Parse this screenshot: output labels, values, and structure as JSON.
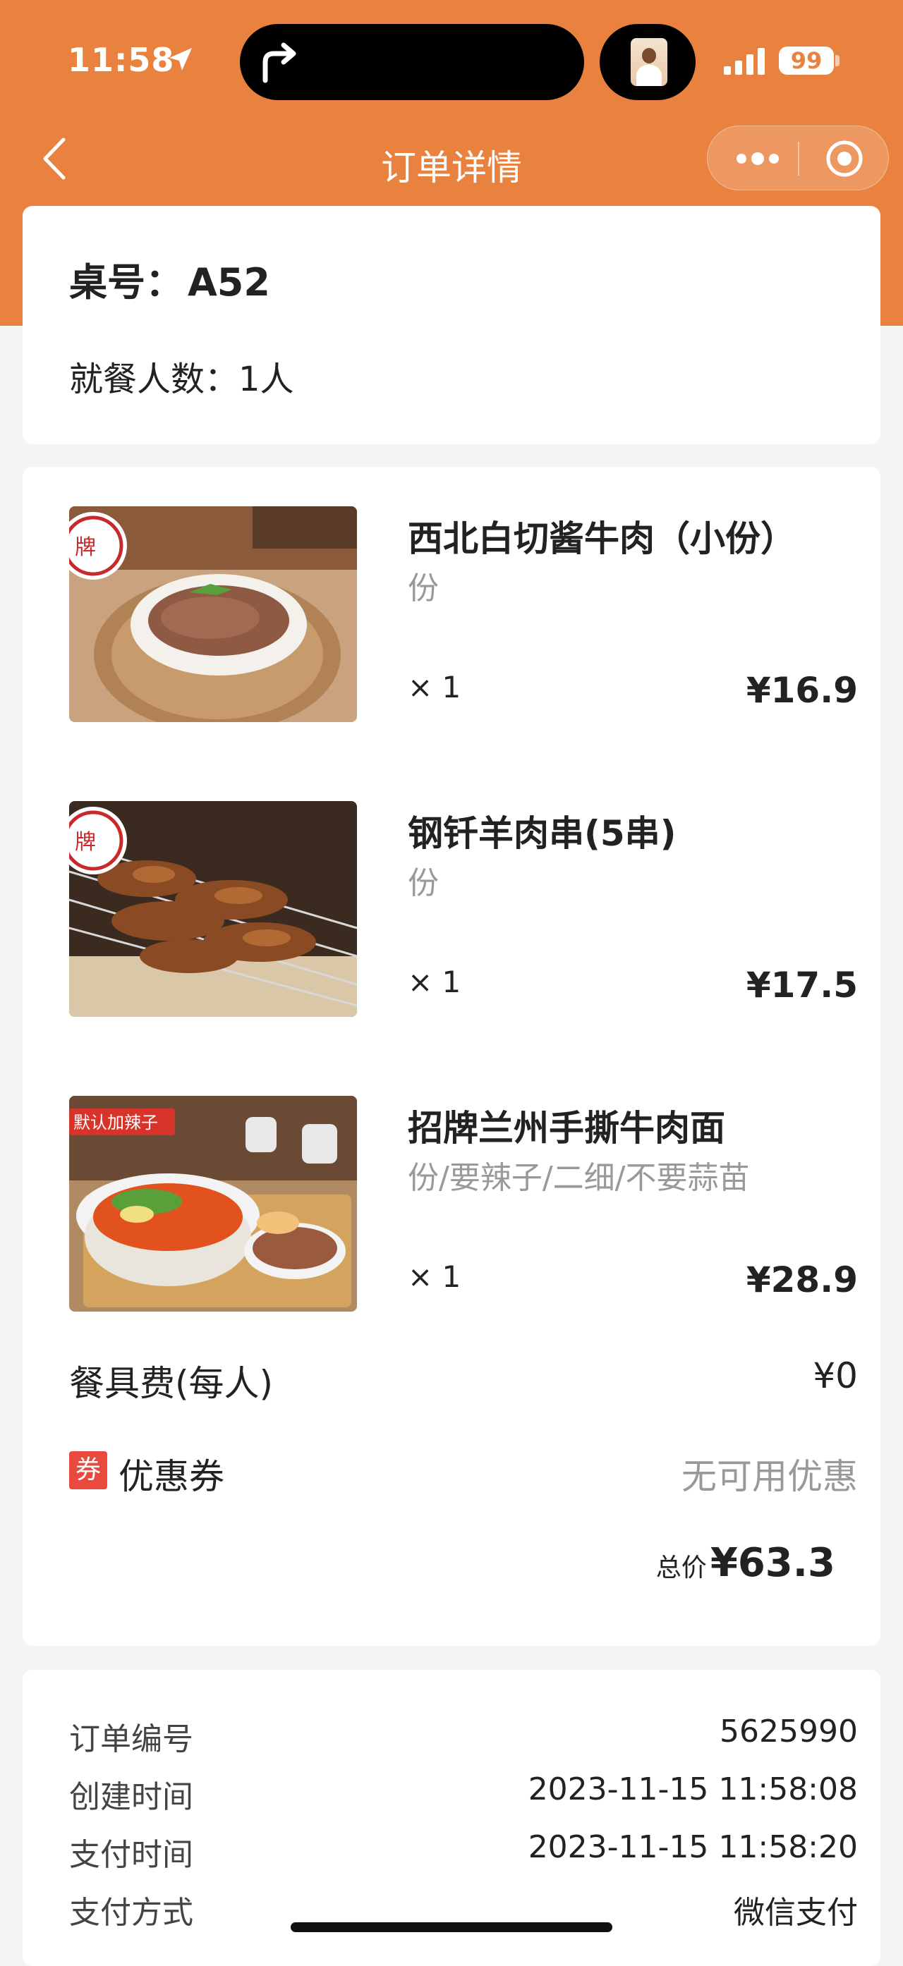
{
  "status_bar": {
    "time": "11:58",
    "battery": "99"
  },
  "nav": {
    "title": "订单详情"
  },
  "table": {
    "label": "桌号：",
    "value": "A52",
    "guests": "就餐人数：1人"
  },
  "items": [
    {
      "name": "西北白切酱牛肉（小份）",
      "spec": "份",
      "qty": "× 1",
      "price": "¥16.9"
    },
    {
      "name": "钢钎羊肉串(5串)",
      "spec": "份",
      "qty": "× 1",
      "price": "¥17.5"
    },
    {
      "name": "招牌兰州手撕牛肉面",
      "spec": "份/要辣子/二细/不要蒜苗",
      "qty": "× 1",
      "price": "¥28.9",
      "tag": "默认加辣子"
    }
  ],
  "fee": {
    "label": "餐具费(每人)",
    "value": "¥0"
  },
  "coupon": {
    "badge": "券",
    "label": "优惠券",
    "value": "无可用优惠"
  },
  "total": {
    "label": "总价",
    "value": "¥63.3"
  },
  "order_info": [
    {
      "label": "订单编号",
      "value": "5625990"
    },
    {
      "label": "创建时间",
      "value": "2023-11-15 11:58:08"
    },
    {
      "label": "支付时间",
      "value": "2023-11-15 11:58:20"
    },
    {
      "label": "支付方式",
      "value": "微信支付"
    }
  ],
  "colors": {
    "header": "#e8823e",
    "coupon_badge": "#e84a3d"
  },
  "icons": [
    "location-arrow-icon",
    "turn-arrow-icon",
    "signal-icon",
    "battery-icon",
    "back-icon",
    "more-icon",
    "record-icon"
  ]
}
